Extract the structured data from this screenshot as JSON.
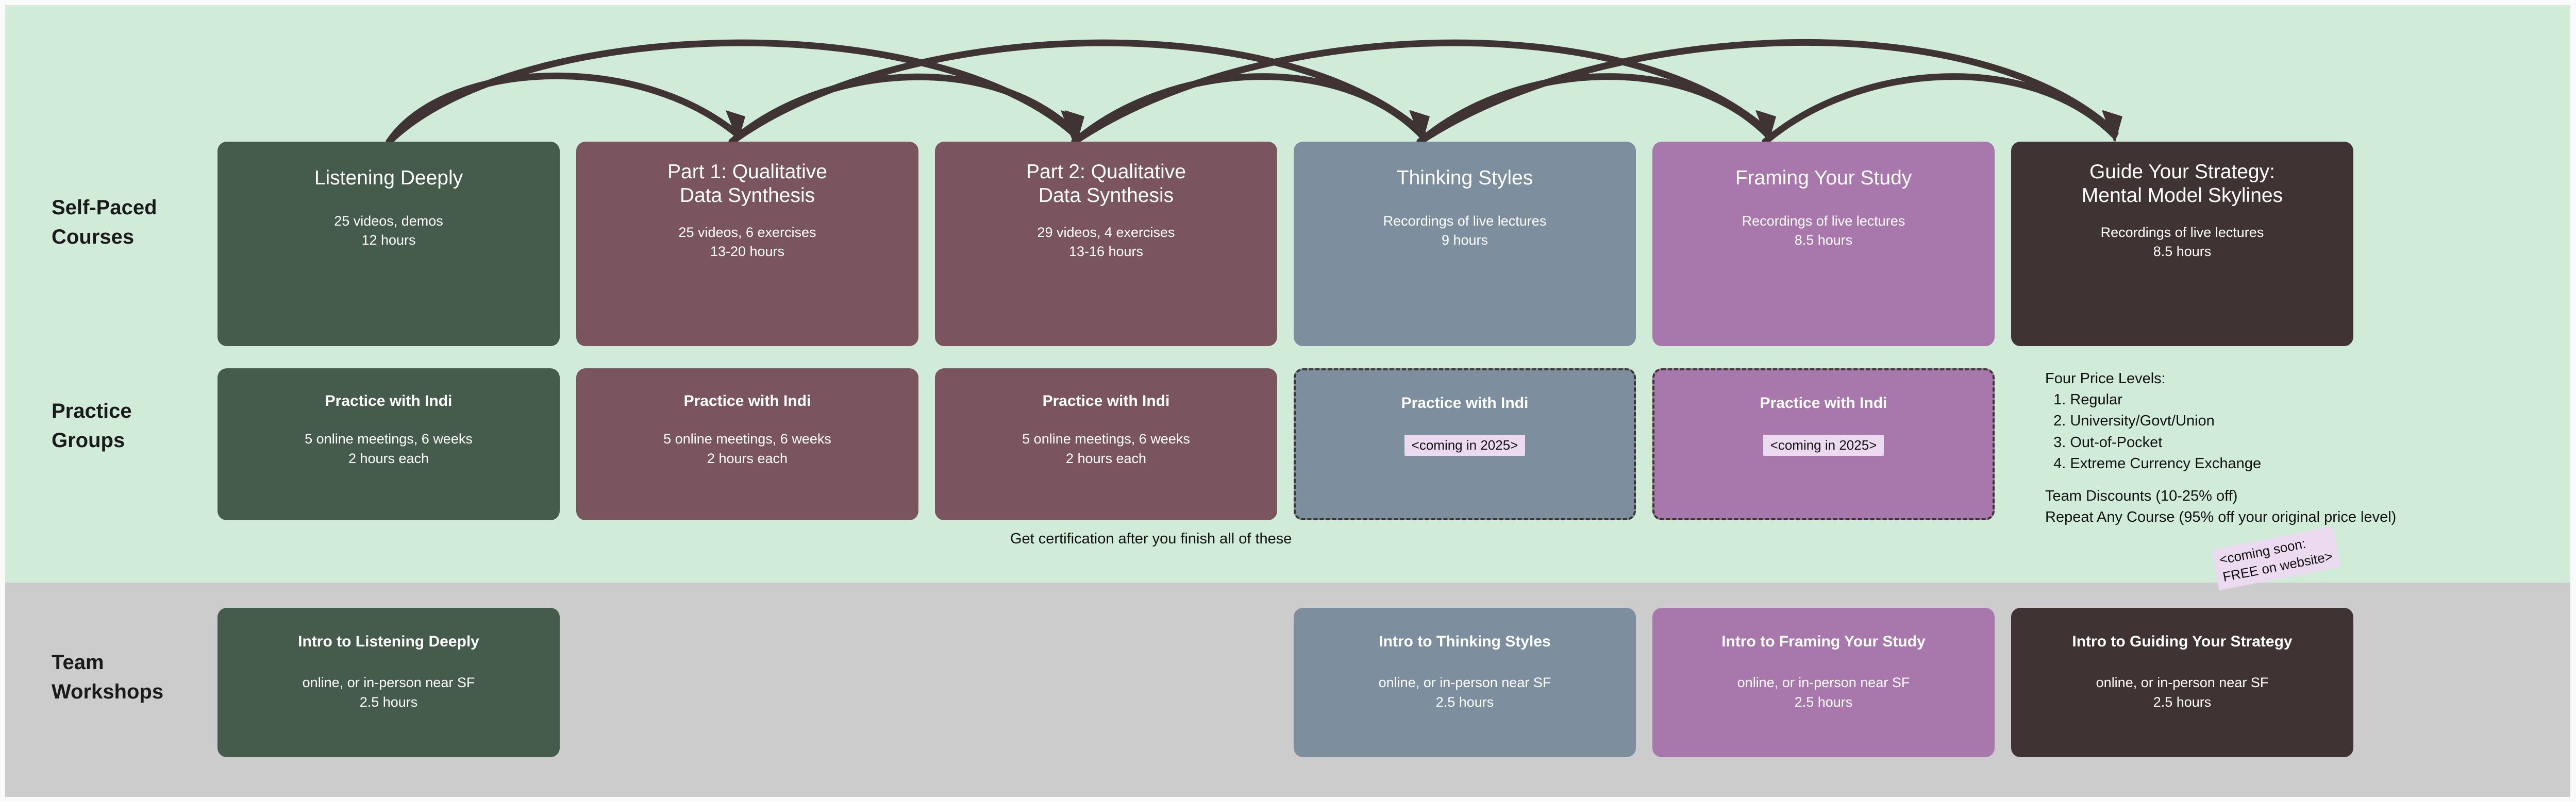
{
  "sections": {
    "green_background": "#d1ebd9",
    "gray_background": "#cccccc"
  },
  "row_labels": {
    "courses": "Self-Paced\nCourses",
    "practice": "Practice\nGroups",
    "workshops": "Team\nWorkshops"
  },
  "self_paced_courses": [
    {
      "title": "Listening Deeply",
      "sub": "25 videos, demos\n12 hours",
      "color": "#455c4c"
    },
    {
      "title": "Part 1: Qualitative\nData Synthesis",
      "sub": "25 videos, 6 exercises\n13-20 hours",
      "color": "#7a5560"
    },
    {
      "title": "Part 2: Qualitative\nData Synthesis",
      "sub": "29 videos, 4 exercises\n13-16 hours",
      "color": "#7a5560"
    },
    {
      "title": "Thinking Styles",
      "sub": "Recordings of live lectures\n9 hours",
      "color": "#7d8f9e"
    },
    {
      "title": "Framing Your Study",
      "sub": "Recordings of live lectures\n8.5 hours",
      "color": "#a878ad"
    },
    {
      "title": "Guide Your Strategy:\nMental Model Skylines",
      "sub": "Recordings of live lectures\n8.5 hours",
      "color": "#3f3334"
    }
  ],
  "coming_soon_sticker": "<coming soon:\nFREE on website>",
  "practice_groups": [
    {
      "title": "Practice with Indi",
      "sub": "5 online meetings, 6 weeks\n2 hours each",
      "badge": "",
      "color": "#455c4c",
      "dashed": false
    },
    {
      "title": "Practice with Indi",
      "sub": "5 online meetings, 6 weeks\n2 hours each",
      "badge": "",
      "color": "#7a5560",
      "dashed": false
    },
    {
      "title": "Practice with Indi",
      "sub": "5 online meetings, 6 weeks\n2 hours each",
      "badge": "",
      "color": "#7a5560",
      "dashed": false
    },
    {
      "title": "Practice with Indi",
      "sub": "",
      "badge": "<coming in 2025>",
      "color": "#7d8f9e",
      "dashed": true
    },
    {
      "title": "Practice with Indi",
      "sub": "",
      "badge": "<coming in 2025>",
      "color": "#a878ad",
      "dashed": true
    }
  ],
  "certification_note": "Get certification after you finish all of these",
  "pricing": {
    "heading": "Four Price Levels:",
    "levels": [
      "  1. Regular",
      "  2. University/Govt/Union",
      "  3. Out-of-Pocket",
      "  4. Extreme Currency Exchange"
    ],
    "team_discount": "Team Discounts (10-25% off)",
    "repeat_discount": "Repeat Any Course (95% off your original price level)"
  },
  "team_workshops": [
    {
      "title": "Intro to Listening Deeply",
      "sub": "online, or in-person near SF\n2.5 hours",
      "color": "#455c4c",
      "column": 0
    },
    {
      "title": "Intro to Thinking Styles",
      "sub": "online, or in-person near SF\n2.5 hours",
      "color": "#7d8f9e",
      "column": 3
    },
    {
      "title": "Intro to Framing Your Study",
      "sub": "online, or in-person near SF\n2.5 hours",
      "color": "#a878ad",
      "column": 4
    },
    {
      "title": "Intro to Guiding Your Strategy",
      "sub": "online, or in-person near SF\n2.5 hours",
      "color": "#3f3334",
      "column": 5
    }
  ],
  "arrow_color": "#3f3334"
}
